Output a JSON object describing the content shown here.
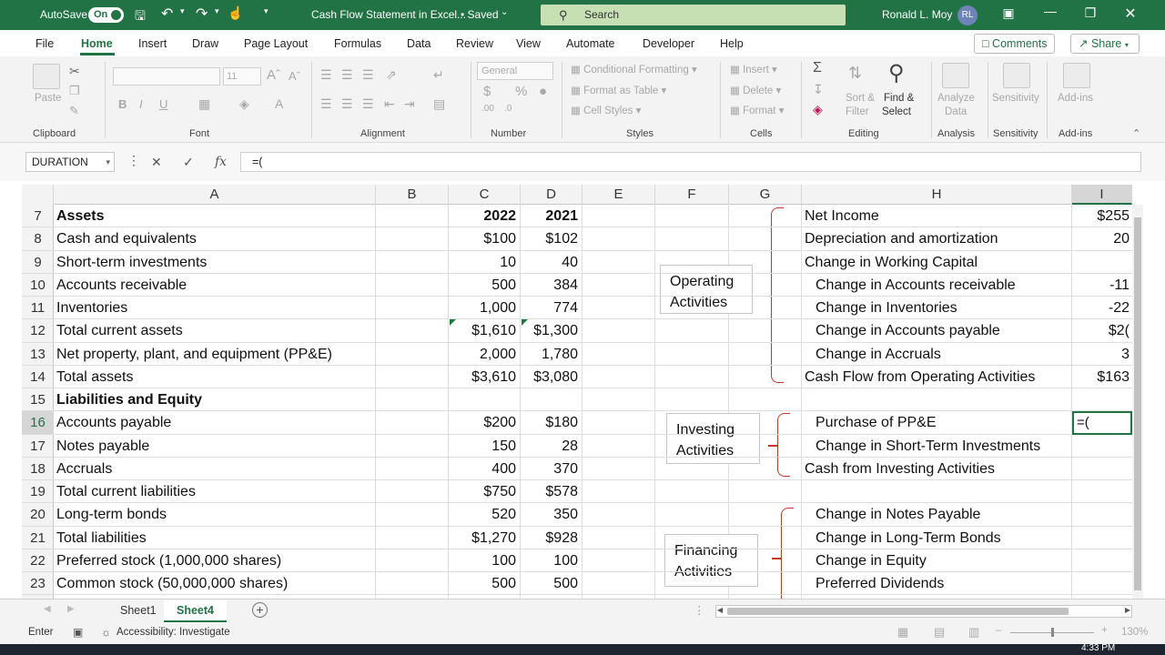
{
  "titlebar": {
    "autosave_label": "AutoSave",
    "autosave_state": "On",
    "doc_title": "Cash Flow Statement in Excel...",
    "saved_status": "• Saved",
    "search_placeholder": "Search",
    "user_name": "Ronald L. Moy",
    "user_initials": "RL"
  },
  "menu": {
    "items": [
      "File",
      "Home",
      "Insert",
      "Draw",
      "Page Layout",
      "Formulas",
      "Data",
      "Review",
      "View",
      "Automate",
      "Developer",
      "Help"
    ],
    "comments": "Comments",
    "share": "Share"
  },
  "ribbon": {
    "clipboard": {
      "paste": "Paste",
      "label": "Clipboard"
    },
    "font": {
      "size": "11",
      "label": "Font"
    },
    "alignment": {
      "label": "Alignment"
    },
    "number": {
      "format": "General",
      "label": "Number"
    },
    "styles": {
      "conditional": "Conditional Formatting",
      "format_table": "Format as Table",
      "cell_styles": "Cell Styles",
      "label": "Styles"
    },
    "cells": {
      "insert": "Insert",
      "delete": "Delete",
      "format": "Format",
      "label": "Cells"
    },
    "editing": {
      "sort1": "Sort &",
      "sort2": "Filter",
      "find1": "Find &",
      "find2": "Select",
      "label": "Editing"
    },
    "analysis": {
      "analyze1": "Analyze",
      "analyze2": "Data",
      "label": "Analysis"
    },
    "sensitivity": {
      "btn": "Sensitivity",
      "label": "Sensitivity"
    },
    "addins": {
      "btn": "Add-ins",
      "label": "Add-ins"
    }
  },
  "formula_bar": {
    "name_box": "DURATION",
    "formula": "=("
  },
  "grid": {
    "columns": [
      "A",
      "B",
      "C",
      "D",
      "E",
      "F",
      "G",
      "H",
      "I"
    ],
    "row_numbers": [
      "7",
      "8",
      "9",
      "10",
      "11",
      "12",
      "13",
      "14",
      "15",
      "16",
      "17",
      "18",
      "19",
      "20",
      "21",
      "22",
      "23"
    ],
    "balance_sheet": [
      {
        "label": "Assets",
        "c": "2022",
        "d": "2021",
        "bold": true
      },
      {
        "label": "Cash and equivalents",
        "c": "$100",
        "d": "$102"
      },
      {
        "label": "Short-term investments",
        "c": "10",
        "d": "40"
      },
      {
        "label": "Accounts receivable",
        "c": "500",
        "d": "384"
      },
      {
        "label": "Inventories",
        "c": "1,000",
        "d": "774"
      },
      {
        "label": "Total current assets",
        "c": "$1,610",
        "d": "$1,300"
      },
      {
        "label": "Net property, plant, and equipment (PP&E)",
        "c": "2,000",
        "d": "1,780"
      },
      {
        "label": "Total assets",
        "c": "$3,610",
        "d": "$3,080"
      },
      {
        "label": "Liabilities and Equity",
        "c": "",
        "d": "",
        "bold": true
      },
      {
        "label": "Accounts payable",
        "c": "$200",
        "d": "$180"
      },
      {
        "label": "Notes payable",
        "c": "150",
        "d": "28"
      },
      {
        "label": "Accruals",
        "c": "400",
        "d": "370"
      },
      {
        "label": "Total current liabilities",
        "c": "$750",
        "d": "$578"
      },
      {
        "label": "Long-term bonds",
        "c": "520",
        "d": "350"
      },
      {
        "label": "Total liabilities",
        "c": "$1,270",
        "d": "$928"
      },
      {
        "label": "Preferred stock (1,000,000 shares)",
        "c": "100",
        "d": "100"
      },
      {
        "label": "Common stock (50,000,000 shares)",
        "c": "500",
        "d": "500"
      }
    ],
    "cash_flow": [
      {
        "label": "Net Income",
        "i": "$255",
        "indent": false
      },
      {
        "label": "Depreciation and amortization",
        "i": "20",
        "indent": false
      },
      {
        "label": "Change in Working Capital",
        "i": "",
        "indent": false
      },
      {
        "label": "Change in Accounts receivable",
        "i": "-11",
        "indent": true
      },
      {
        "label": "Change in Inventories",
        "i": "-22",
        "indent": true
      },
      {
        "label": "Change in Accounts payable",
        "i": "$2(",
        "indent": true
      },
      {
        "label": "Change in Accruals",
        "i": "3",
        "indent": true
      },
      {
        "label": "Cash Flow from Operating Activities",
        "i": "$163",
        "indent": false
      },
      {
        "label": "",
        "i": "",
        "indent": false
      },
      {
        "label": "Purchase of PP&E",
        "i": "",
        "indent": true
      },
      {
        "label": "Change in Short-Term Investments",
        "i": "",
        "indent": true
      },
      {
        "label": "Cash from Investing Activities",
        "i": "",
        "indent": false
      },
      {
        "label": "",
        "i": "",
        "indent": false
      },
      {
        "label": "Change in Notes Payable",
        "i": "",
        "indent": true
      },
      {
        "label": "Change in Long-Term Bonds",
        "i": "",
        "indent": true
      },
      {
        "label": "Change in Equity",
        "i": "",
        "indent": true
      },
      {
        "label": "Preferred Dividends",
        "i": "",
        "indent": true
      }
    ],
    "active_cell_value": "=(",
    "group_boxes": {
      "operating": [
        "Operating",
        "Activities"
      ],
      "investing": [
        "Investing",
        "Activities"
      ],
      "financing": [
        "Financing",
        "Activities"
      ]
    }
  },
  "sheet_tabs": [
    "Sheet1",
    "Sheet4"
  ],
  "status": {
    "mode": "Enter",
    "accessibility": "Accessibility: Investigate",
    "zoom": "130%"
  },
  "taskbar": {
    "time": "4:33 PM"
  },
  "colors": {
    "excel_green": "#217346",
    "brace_red": "#c0392b"
  }
}
